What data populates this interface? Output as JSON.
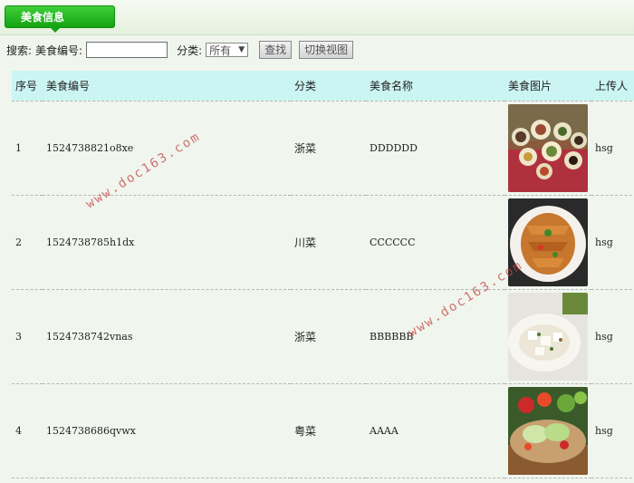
{
  "header": {
    "tab_label": "美食信息"
  },
  "search": {
    "label": "搜索:",
    "code_label": "美食编号:",
    "code_value": "",
    "category_label": "分类:",
    "category_selected": "所有",
    "find_button": "查找",
    "switch_view_button": "切换视图"
  },
  "table": {
    "headers": [
      "序号",
      "美食编号",
      "分类",
      "美食名称",
      "美食图片",
      "上传人"
    ],
    "rows": [
      {
        "index": "1",
        "code": "1524738821o8xe",
        "category": "浙菜",
        "name": "DDDDDD",
        "image": "food-photo-platter",
        "uploader": "hsg"
      },
      {
        "index": "2",
        "code": "1524738785h1dx",
        "category": "川菜",
        "name": "CCCCCC",
        "image": "food-photo-fish-dish",
        "uploader": "hsg"
      },
      {
        "index": "3",
        "code": "1524738742vnas",
        "category": "浙菜",
        "name": "BBBBBB",
        "image": "food-photo-tofu-dish",
        "uploader": "hsg"
      },
      {
        "index": "4",
        "code": "1524738686qvwx",
        "category": "粤菜",
        "name": "AAAA",
        "image": "food-photo-salad",
        "uploader": "hsg"
      }
    ]
  },
  "watermark": {
    "text": "www.doc163.com"
  },
  "colors": {
    "tab": "#14a312",
    "header_row": "#cbf5f3",
    "background": "#f0f6ee",
    "watermark": "#c44444"
  }
}
